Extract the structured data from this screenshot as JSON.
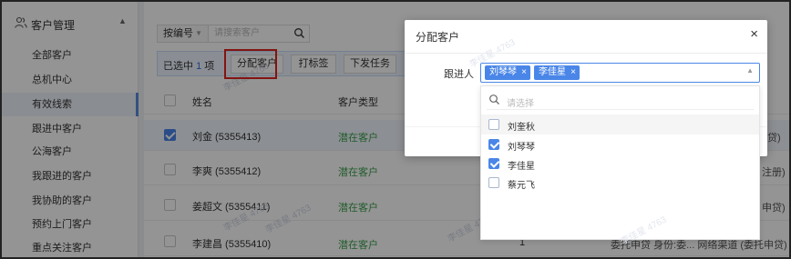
{
  "sidebar": {
    "section_title": "客户管理",
    "items": [
      {
        "label": "全部客户",
        "active": false
      },
      {
        "label": "总机中心",
        "active": false
      },
      {
        "label": "有效线索",
        "active": true
      },
      {
        "label": "跟进中客户",
        "active": false
      },
      {
        "label": "公海客户",
        "active": false
      },
      {
        "label": "我跟进的客户",
        "active": false
      },
      {
        "label": "我协助的客户",
        "active": false
      },
      {
        "label": "预约上门客户",
        "active": false
      },
      {
        "label": "重点关注客户",
        "active": false
      }
    ]
  },
  "search": {
    "field_select": "按编号",
    "placeholder": "请搜索客户"
  },
  "selection_bar": {
    "prefix": "已选中",
    "count": "1",
    "suffix": "项",
    "buttons": [
      "分配客户",
      "打标签",
      "下发任务"
    ]
  },
  "table": {
    "headers": [
      "姓名",
      "客户类型"
    ],
    "rows": [
      {
        "name": "刘金 (5355413)",
        "type": "潜在客户",
        "checked": true,
        "extra": "",
        "tail": "贷)"
      },
      {
        "name": "李爽 (5355412)",
        "type": "潜在客户",
        "checked": false,
        "extra": "",
        "tail": "注册)"
      },
      {
        "name": "姜超文 (5355411)",
        "type": "潜在客户",
        "checked": false,
        "extra": "",
        "tail": "申贷)"
      },
      {
        "name": "李建昌 (5355410)",
        "type": "潜在客户",
        "checked": false,
        "extra": "1",
        "tail": "委托申贷 身份:委...   网络渠道 (委托申贷)"
      }
    ]
  },
  "watermark": "李佳星 4763",
  "dialog": {
    "title": "分配客户",
    "close": "×",
    "field_label": "跟进人",
    "selected_tags": [
      "刘琴琴",
      "李佳星"
    ],
    "dropdown": {
      "search_placeholder": "请选择",
      "options": [
        {
          "label": "刘奎秋",
          "checked": false
        },
        {
          "label": "刘琴琴",
          "checked": true
        },
        {
          "label": "李佳星",
          "checked": true
        },
        {
          "label": "蔡元飞",
          "checked": false
        }
      ]
    }
  },
  "colors": {
    "accent": "#4a86e8",
    "highlight_border": "#e0241e",
    "potential_customer_text": "#3aa04a"
  }
}
